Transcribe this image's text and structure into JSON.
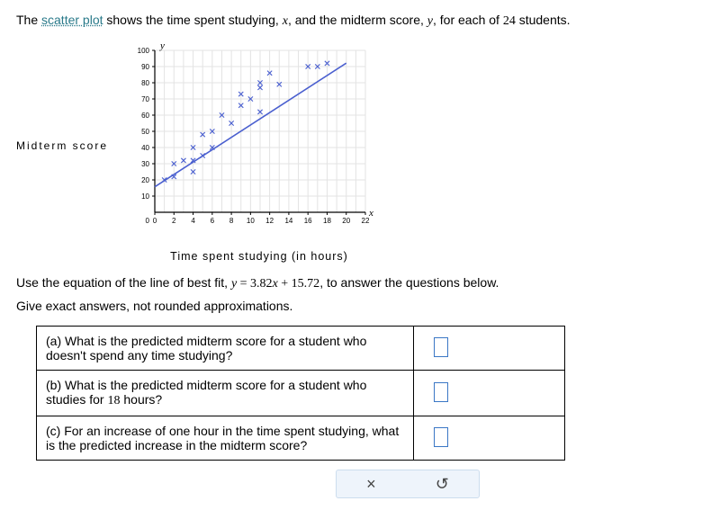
{
  "intro": {
    "pre": "The ",
    "link": "scatter plot",
    "post1": " shows the time spent studying, ",
    "xvar": "x",
    "post2": ", and the midterm score, ",
    "yvar": "y",
    "post3": ", for each of ",
    "n": "24",
    "post4": " students."
  },
  "chart": {
    "ylabel_text": "Midterm  score",
    "xlabel_text": "Time  spent  studying  (in  hours)",
    "y_axis_var": "y",
    "x_axis_var": "x"
  },
  "equation_line": {
    "pre": "Use the equation of the line of best fit, ",
    "eq": "y = 3.82x + 15.72",
    "post": ", to answer the questions below."
  },
  "instruction": "Give exact answers, not rounded approximations.",
  "questions": {
    "a": "(a) What is the predicted midterm score for a student who doesn't spend any time studying?",
    "b_pre": "(b) What is the predicted midterm score for a student who studies for ",
    "b_hours": "18",
    "b_post": " hours?",
    "c": "(c) For an increase of one hour in the time spent studying, what is the predicted increase in the midterm score?"
  },
  "chart_data": {
    "type": "scatter",
    "title": "",
    "xlabel": "Time spent studying (in hours)",
    "ylabel": "Midterm score",
    "xlim": [
      0,
      22
    ],
    "ylim": [
      0,
      100
    ],
    "xticks": [
      0,
      2,
      4,
      6,
      8,
      10,
      12,
      14,
      16,
      18,
      20,
      22
    ],
    "yticks": [
      10,
      20,
      30,
      40,
      50,
      60,
      70,
      80,
      90,
      100
    ],
    "grid": true,
    "series": [
      {
        "name": "students",
        "marker": "x",
        "color": "#4a5fcf",
        "points": [
          [
            1,
            20
          ],
          [
            2,
            22
          ],
          [
            2,
            30
          ],
          [
            3,
            32
          ],
          [
            4,
            25
          ],
          [
            4,
            40
          ],
          [
            4,
            32
          ],
          [
            5,
            35
          ],
          [
            5,
            48
          ],
          [
            6,
            50
          ],
          [
            6,
            40
          ],
          [
            7,
            60
          ],
          [
            8,
            55
          ],
          [
            9,
            66
          ],
          [
            9,
            73
          ],
          [
            10,
            70
          ],
          [
            11,
            80
          ],
          [
            11,
            77
          ],
          [
            11,
            62
          ],
          [
            12,
            86
          ],
          [
            13,
            79
          ],
          [
            16,
            90
          ],
          [
            17,
            90
          ],
          [
            18,
            92
          ]
        ]
      }
    ],
    "best_fit_line": {
      "slope": 3.82,
      "intercept": 15.72,
      "x_range": [
        0,
        20
      ],
      "color": "#4a5fcf"
    }
  }
}
